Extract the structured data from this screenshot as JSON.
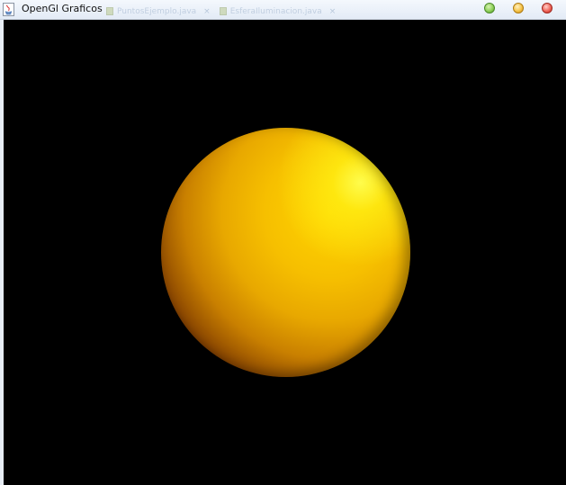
{
  "window": {
    "title": "OpenGl Graficos",
    "app_icon": "java-icon",
    "controls": {
      "minimize": "minimize-button",
      "maximize": "maximize-button",
      "close": "close-button"
    }
  },
  "background_tabs": [
    {
      "label": "PuntosEjemplo.java",
      "icon": "java-file-icon"
    },
    {
      "label": "EsferaIluminacion.java",
      "icon": "java-file-icon"
    }
  ],
  "scene": {
    "background_color": "#000000",
    "object": "sphere",
    "sphere_color": "#ffd400",
    "highlight_color": "#ffff33",
    "shadow_color": "#2a0800"
  }
}
